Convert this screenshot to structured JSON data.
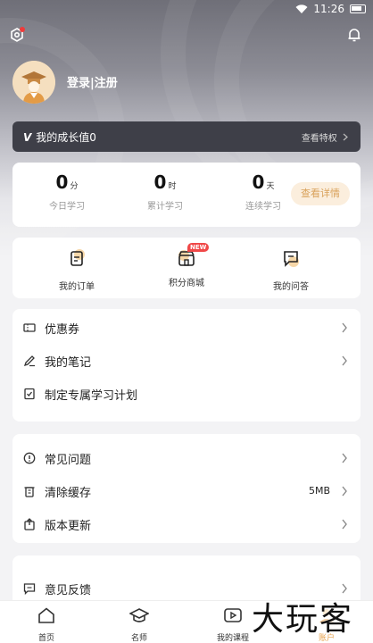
{
  "status_bar": {
    "time": "11:26"
  },
  "profile": {
    "login_text": "登录|注册"
  },
  "growth": {
    "badge": "V",
    "label": "我的成长值0",
    "link": "查看特权"
  },
  "stats": [
    {
      "value": "0",
      "unit": "分",
      "label": "今日学习"
    },
    {
      "value": "0",
      "unit": "时",
      "label": "累计学习"
    },
    {
      "value": "0",
      "unit": "天",
      "label": "连续学习"
    }
  ],
  "stats_button": "查看详情",
  "quick_links": [
    {
      "label": "我的订单",
      "icon": "order-icon"
    },
    {
      "label": "积分商城",
      "icon": "shop-icon",
      "badge": "NEW"
    },
    {
      "label": "我的问答",
      "icon": "qa-icon"
    }
  ],
  "menu_group_1": [
    {
      "label": "优惠券",
      "icon": "coupon-icon"
    },
    {
      "label": "我的笔记",
      "icon": "pen-icon"
    },
    {
      "label": "制定专属学习计划",
      "icon": "plan-icon"
    }
  ],
  "menu_group_2": [
    {
      "label": "常见问题",
      "icon": "info-icon"
    },
    {
      "label": "清除缓存",
      "icon": "trash-icon",
      "value": "5MB"
    },
    {
      "label": "版本更新",
      "icon": "update-icon"
    }
  ],
  "menu_group_3": [
    {
      "label": "意见反馈",
      "icon": "feedback-icon"
    }
  ],
  "tabs": [
    {
      "label": "首页",
      "icon": "home-icon"
    },
    {
      "label": "名师",
      "icon": "graduation-cap-icon"
    },
    {
      "label": "我的课程",
      "icon": "play-icon"
    },
    {
      "label": "账户",
      "icon": "account-icon",
      "active": true
    }
  ],
  "watermark": "大玩客",
  "colors": {
    "accent": "#e7a24d",
    "growth_bar": "#3e3f48",
    "badge_red": "#f04848"
  }
}
